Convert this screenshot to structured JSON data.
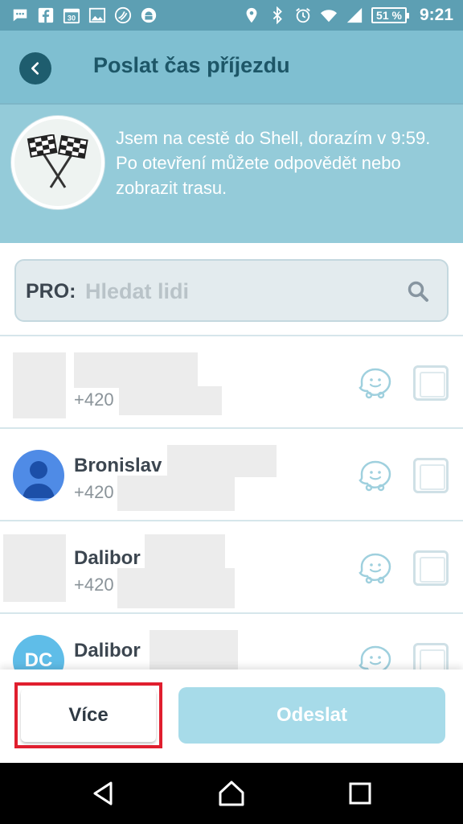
{
  "status_bar": {
    "battery_percent": "51 %",
    "time": "9:21",
    "left_icons": [
      "message-icon",
      "facebook-icon",
      "calendar-icon",
      "gallery-icon",
      "waze-status-icon",
      "android-icon"
    ],
    "right_icons": [
      "location-icon",
      "bluetooth-icon",
      "alarm-icon",
      "wifi-icon",
      "signal-icon",
      "battery-icon"
    ],
    "calendar_day": "30"
  },
  "app_bar": {
    "title": "Poslat čas příjezdu"
  },
  "banner": {
    "line1": "Jsem na cestě do Shell, dorazím v 9:59.",
    "line2": "Po otevření můžete odpovědět nebo zobrazit trasu."
  },
  "search": {
    "label": "PRO:",
    "placeholder": "Hledat lidi"
  },
  "contacts": [
    {
      "name": "",
      "phone_prefix": "+420",
      "avatar": "blurred",
      "checked": false
    },
    {
      "name": "Bronislav",
      "phone_prefix": "+420",
      "avatar": "person",
      "checked": false
    },
    {
      "name": "Dalibor",
      "phone_prefix": "+420",
      "avatar": "blurred",
      "checked": false
    },
    {
      "name": "Dalibor",
      "phone_prefix": "",
      "avatar": "initials",
      "initials": "DC",
      "checked": false
    }
  ],
  "actions": {
    "more_label": "Více",
    "send_label": "Odeslat"
  },
  "colors": {
    "status_bar": "#5d9fb3",
    "app_bar": "#7fbfd1",
    "banner": "#94cbd9",
    "title_text": "#1d5667",
    "send_button": "#a7dbe9",
    "highlight": "#e01e2e"
  }
}
